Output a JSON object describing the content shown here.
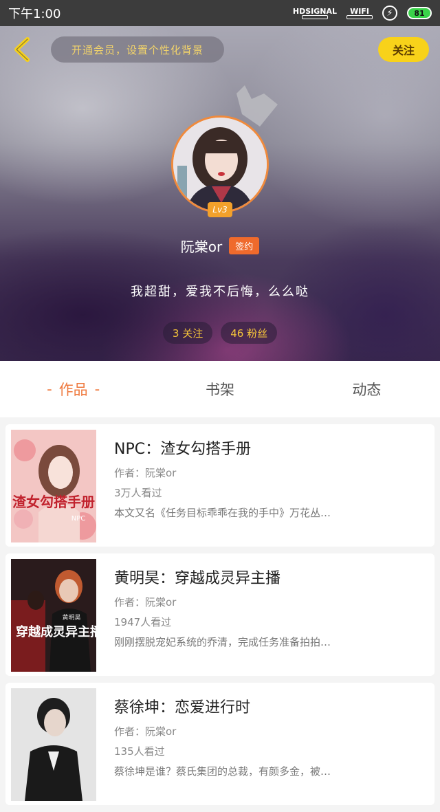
{
  "status_bar": {
    "time": "下午1:00",
    "hd_label": "HD",
    "signal_label": "SIGNAL",
    "wifi_label": "WIFI",
    "battery": "81"
  },
  "header": {
    "promo_text": "开通会员，设置个性化背景",
    "follow_label": "关注",
    "level": "Lv3",
    "username": "阮棠or",
    "sign_badge": "签约",
    "bio": "我超甜，爱我不后悔，么么哒",
    "stats": {
      "following": "3 关注",
      "fans": "46 粉丝"
    }
  },
  "tabs": [
    {
      "label": "作品",
      "active": true,
      "dash": "-"
    },
    {
      "label": "书架",
      "active": false
    },
    {
      "label": "动态",
      "active": false
    }
  ],
  "books": [
    {
      "title": "NPC：渣女勾搭手册",
      "author": "作者：阮棠or",
      "views": "3万人看过",
      "desc": "本文又名《任务目标乖乖在我的手中》万花丛…",
      "cover_text": "渣女勾搭手册",
      "cover_tag": "NPC"
    },
    {
      "title": "黄明昊：穿越成灵异主播",
      "author": "作者：阮棠or",
      "views": "1947人看过",
      "desc": "刚刚摆脱宠妃系统的乔清，完成任务准备拍拍…",
      "cover_text": "穿越成灵异主播",
      "cover_tag": "黄明昊"
    },
    {
      "title": "蔡徐坤：恋爱进行时",
      "author": "作者：阮棠or",
      "views": "135人看过",
      "desc": "蔡徐坤是谁？蔡氏集团的总裁，有颜多金，被…"
    }
  ],
  "colors": {
    "accent_orange": "#ef7a3f",
    "follow_yellow": "#f8d21a",
    "stat_gold": "#f5c43a"
  }
}
